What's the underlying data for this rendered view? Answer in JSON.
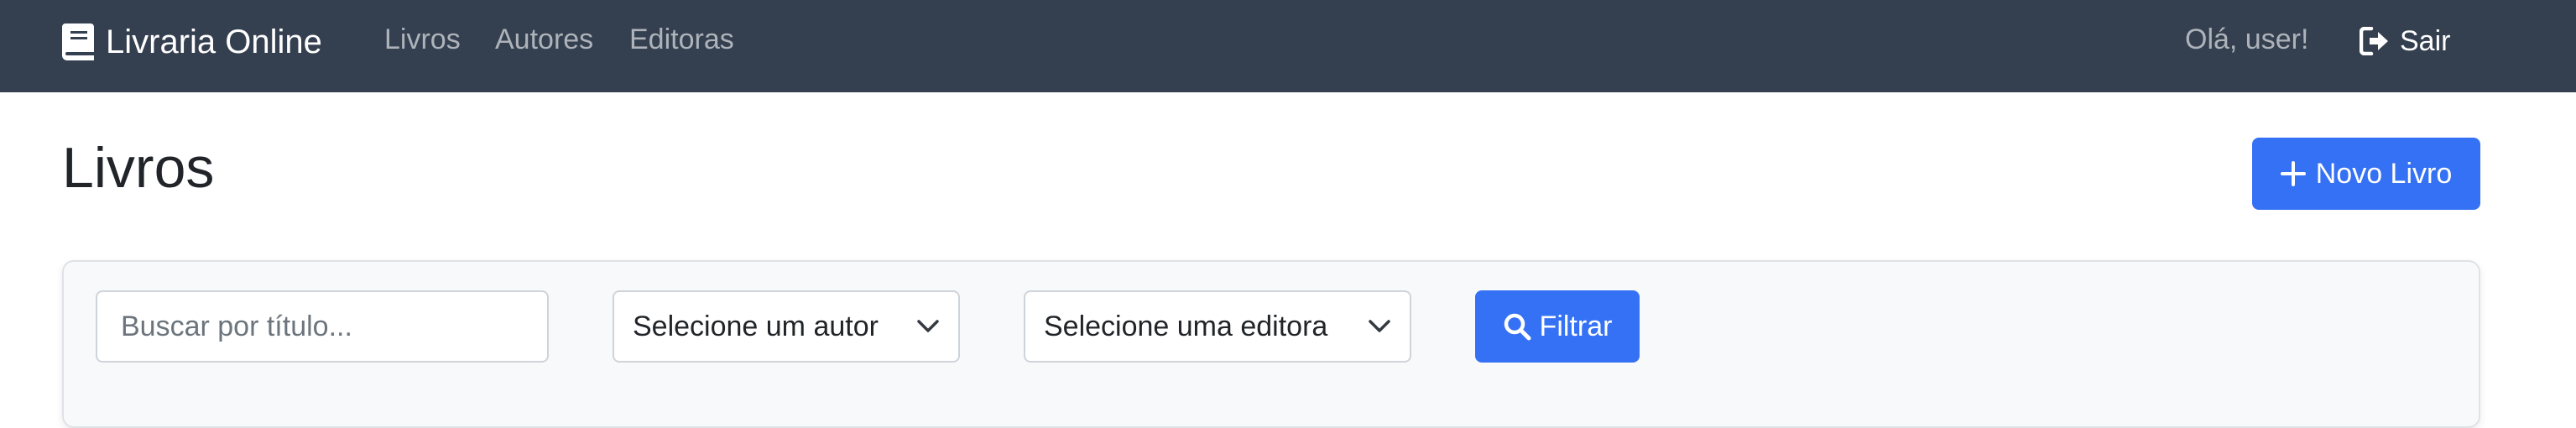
{
  "navbar": {
    "brand": "Livraria Online",
    "brand_icon": "book-icon",
    "links": [
      "Livros",
      "Autores",
      "Editoras"
    ],
    "greeting": "Olá, user!",
    "logout_label": "Sair",
    "logout_icon": "sign-out-icon",
    "background_color": "#343f50"
  },
  "main": {
    "title": "Livros",
    "new_button_label": "Novo Livro",
    "new_button_icon": "plus-icon",
    "accent_color": "#3571f4"
  },
  "filters": {
    "search_placeholder": "Buscar por título...",
    "search_value": "",
    "author_select": "Selecione um autor",
    "publisher_select": "Selecione uma editora",
    "filter_button_label": "Filtrar",
    "filter_button_icon": "search-icon"
  }
}
